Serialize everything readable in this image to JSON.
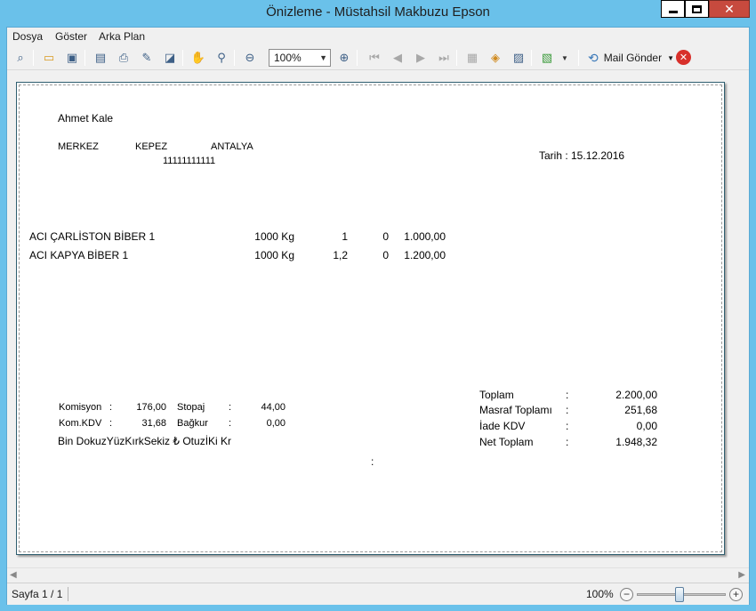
{
  "window": {
    "title": "Önizleme - Müstahsil Makbuzu Epson"
  },
  "menu": {
    "items": [
      "Dosya",
      "Göster",
      "Arka Plan"
    ]
  },
  "toolbar": {
    "zoom_value": "100%",
    "mail_label": "Mail Gönder",
    "icons": [
      "find-icon",
      "open-icon",
      "save-icon",
      "print-setup-icon",
      "print-icon",
      "quick-print-icon",
      "page-setup-icon",
      "hand-icon",
      "magnifier-icon",
      "zoom-out-icon",
      "zoom-in-icon",
      "first-page-icon",
      "previous-page-icon",
      "next-page-icon",
      "last-page-icon",
      "multi-page-icon",
      "fill-color-icon",
      "watermark-icon",
      "export-icon",
      "mail-icon",
      "close-preview-icon"
    ]
  },
  "report": {
    "name": "Ahmet Kale",
    "address": {
      "district": "MERKEZ",
      "town": "KEPEZ",
      "city": "ANTALYA",
      "number": "11111111111"
    },
    "date": "Tarih : 15.12.2016",
    "lines": [
      {
        "product": "ACI ÇARLİSTON BİBER 1",
        "qty": "1000 Kg",
        "price": "1",
        "zero": "0",
        "amount": "1.000,00"
      },
      {
        "product": "ACI KAPYA BİBER 1",
        "qty": "1000 Kg",
        "price": "1,2",
        "zero": "0",
        "amount": "1.200,00"
      }
    ],
    "left_totals": {
      "komisyon_label": "Komisyon",
      "komisyon_value": "176,00",
      "stopaj_label": "Stopaj",
      "stopaj_value": "44,00",
      "komkdv_label": "Kom.KDV",
      "komkdv_value": "31,68",
      "bagkur_label": "Bağkur",
      "bagkur_value": "0,00",
      "colon": ":"
    },
    "amount_in_words": "Bin DokuzYüzKırkSekiz ₺ OtuzİKi Kr",
    "stray_colon": ":",
    "right_totals": [
      {
        "label": "Toplam",
        "colon": ":",
        "value": "2.200,00"
      },
      {
        "label": "Masraf Toplamı",
        "colon": ":",
        "value": "251,68"
      },
      {
        "label": "İade KDV",
        "colon": ":",
        "value": "0,00"
      },
      {
        "label": "Net Toplam",
        "colon": ":",
        "value": "1.948,32"
      }
    ]
  },
  "status": {
    "page_info": "Sayfa 1 / 1",
    "zoom": "100%"
  }
}
